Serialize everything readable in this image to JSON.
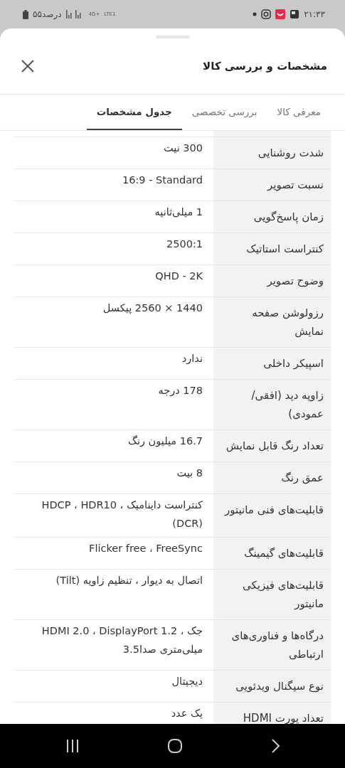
{
  "status_bar": {
    "time": "۲۱:۳۳",
    "battery": "۵۵درصد",
    "network": "4G+",
    "volte": "LTE1"
  },
  "sheet": {
    "title": "مشخصات و بررسی کالا"
  },
  "tabs": [
    {
      "label": "معرفی کالا",
      "selected": false
    },
    {
      "label": "بررسی تخصصی",
      "selected": false
    },
    {
      "label": "جدول مشخصات",
      "selected": true
    }
  ],
  "specs": [
    {
      "name": "شدت روشنایی",
      "value": "300 نیت"
    },
    {
      "name": "نسبت تصویر",
      "value": "16:9 - Standard"
    },
    {
      "name": "زمان پاسخ‌گویی",
      "value": "1 میلی‌ثانیه"
    },
    {
      "name": "کنتراست استاتیک",
      "value": "2500:1"
    },
    {
      "name": "وضوح تصویر",
      "value": "QHD - 2K"
    },
    {
      "name": "رزولوشن صفحه نمایش",
      "value": "1440 × 2560 پیکسل"
    },
    {
      "name": "اسپیکر داخلی",
      "value": "ندارد"
    },
    {
      "name": "زاویه دید (افقی/عمودی)",
      "value": "178 درجه"
    },
    {
      "name": "تعداد رنگ قابل نمایش",
      "value": "16.7 میلیون رنگ"
    },
    {
      "name": "عمق رنگ",
      "value": "8 بیت"
    },
    {
      "name": "قابلیت‌های فنی مانیتور",
      "value": "کنتراست داینامیک ، HDCP ، HDR10 (DCR)"
    },
    {
      "name": "قابلیت‌های گیمینگ",
      "value": "Flicker free ، FreeSync"
    },
    {
      "name": "قابلیت‌های فیزیکی مانیتور",
      "value": "اتصال به دیوار ، تنظیم زاویه (Tilt)"
    },
    {
      "name": "درگاه‌ها و فناوری‌های ارتباطی",
      "value": "جک ، HDMI 2.0 ، DisplayPort 1.2 میلی‌متری صدا3.5"
    },
    {
      "name": "نوع سیگنال ویدئویی",
      "value": "دیجیتال"
    },
    {
      "name": "تعداد پورت HDMI",
      "value": "یک عدد"
    }
  ]
}
